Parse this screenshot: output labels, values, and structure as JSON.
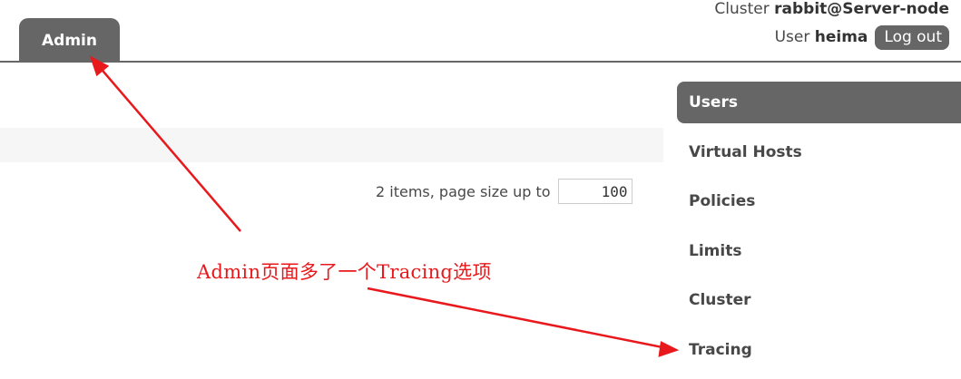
{
  "header": {
    "cluster_label": "Cluster",
    "cluster_name": "rabbit@Server-node",
    "user_label": "User",
    "user_name": "heima",
    "logout_label": "Log out"
  },
  "tabs": [
    {
      "label": "Admin",
      "active": true
    }
  ],
  "pagination": {
    "summary": "2 items, page size up to",
    "page_size": "100"
  },
  "sidebar": {
    "items": [
      {
        "label": "Users",
        "active": true
      },
      {
        "label": "Virtual Hosts"
      },
      {
        "label": "Policies"
      },
      {
        "label": "Limits"
      },
      {
        "label": "Cluster"
      },
      {
        "label": "Tracing"
      }
    ]
  },
  "annotation": {
    "text": "Admin页面多了一个Tracing选项",
    "color": "#e8191c"
  },
  "colors": {
    "tab_bg": "#666666",
    "accent_red": "#e8191c"
  }
}
